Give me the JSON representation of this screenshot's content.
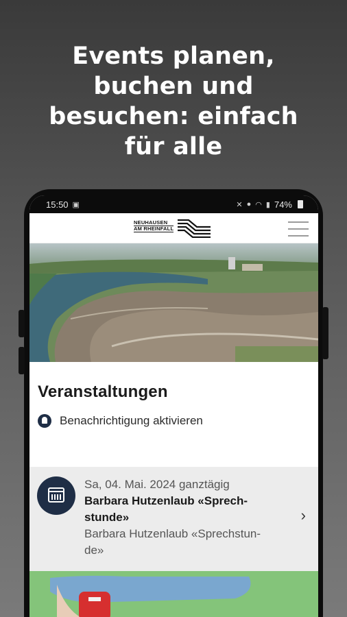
{
  "headline": {
    "line1": "Events planen,",
    "line2": "buchen und",
    "line3": "besuchen: einfach",
    "line4": "für alle"
  },
  "statusbar": {
    "time": "15:50",
    "left_icon": "screenshot-icon",
    "right_icons": [
      "mute-icon",
      "location-icon",
      "wifi-icon",
      "signal-icon"
    ],
    "battery": "74%"
  },
  "app": {
    "logo_line1": "NEUHAUSEN",
    "logo_line2": "AM RHEINFALL",
    "menu_icon": "hamburger-menu-icon"
  },
  "page": {
    "title": "Veranstaltungen",
    "notify_label": "Benachrichtigung aktivieren"
  },
  "event": {
    "date": "Sa, 04. Mai. 2024 ganztägig",
    "title_line1": "Barbara Hutzenlaub «Sprech-",
    "title_line2": "stunde»",
    "sub_line1": "Barbara Hutzenlaub «Sprechstun-",
    "sub_line2": "de»",
    "chevron": "›"
  },
  "colors": {
    "navy": "#1f2e46",
    "event_bg": "#ececec",
    "green": "#84c47a"
  }
}
